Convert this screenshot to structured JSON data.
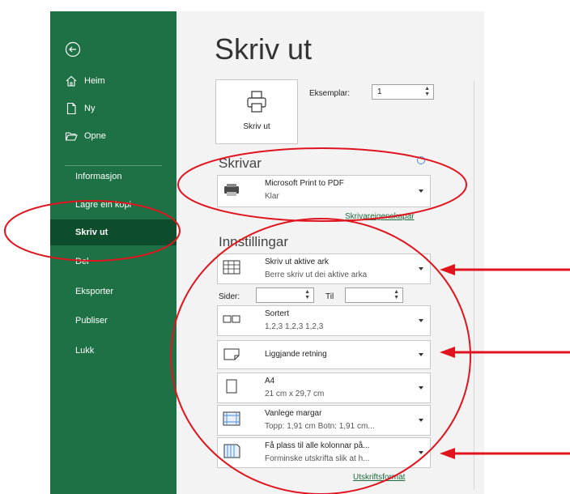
{
  "sidebar": {
    "items": [
      {
        "label": "Heim",
        "icon": "home-icon"
      },
      {
        "label": "Ny",
        "icon": "new-document-icon"
      },
      {
        "label": "Opne",
        "icon": "folder-open-icon"
      },
      {
        "label": "Informasjon"
      },
      {
        "label": "Lagre ein kopi"
      },
      {
        "label": "Skriv ut",
        "active": true
      },
      {
        "label": "Del"
      },
      {
        "label": "Eksporter"
      },
      {
        "label": "Publiser"
      },
      {
        "label": "Lukk"
      }
    ]
  },
  "main": {
    "title": "Skriv ut",
    "print_button": "Skriv ut",
    "copies_label": "Eksemplar:",
    "copies_value": "1",
    "printer_section": "Skrivar",
    "printer": {
      "name": "Microsoft Print to PDF",
      "status": "Klar"
    },
    "printer_properties": "Skrivareigenskapar",
    "settings_section": "Innstillingar",
    "settings": [
      {
        "line1": "Skriv ut aktive ark",
        "line2": "Berre skriv ut dei aktive arka"
      },
      {
        "line1": "Sortert",
        "line2": "1,2,3   1,2,3   1,2,3"
      },
      {
        "line1": "Liggjande retning"
      },
      {
        "line1": "A4",
        "line2": "21 cm x 29,7 cm"
      },
      {
        "line1": "Vanlege margar",
        "line2": "Topp: 1,91 cm Botn: 1,91 cm..."
      },
      {
        "line1": "Få plass til alle kolonnar på...",
        "line2": "Forminske utskrifta slik at h..."
      }
    ],
    "pages_label": "Sider:",
    "to_label": "Til",
    "page_setup_link": "Utskriftsformat"
  },
  "colors": {
    "sidebar": "#1e7145",
    "sidebar_active": "#0e4d2b",
    "annotation": "#e0141e",
    "link": "#1e6b3f"
  }
}
